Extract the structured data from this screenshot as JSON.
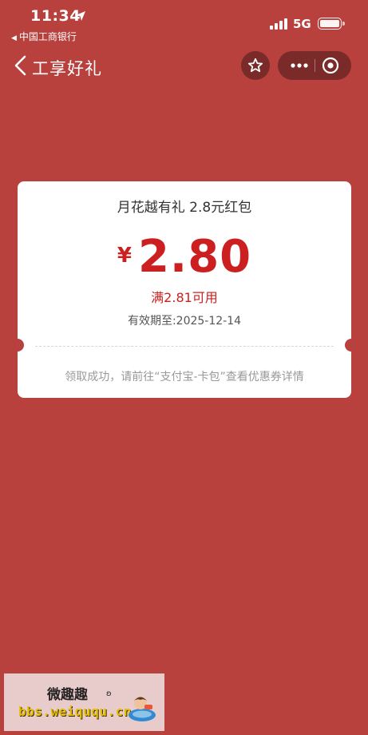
{
  "status_bar": {
    "time": "11:34",
    "back_app": "中国工商银行",
    "network": "5G"
  },
  "nav": {
    "title": "工享好礼"
  },
  "coupon": {
    "title": "月花越有礼  2.8元红包",
    "currency": "¥",
    "amount": "2.80",
    "threshold": "满2.81可用",
    "valid_until": "有效期至:2025-12-14",
    "tip": "领取成功，请前往“支付宝-卡包”查看优惠券详情"
  },
  "watermark": {
    "title": "微趣趣",
    "url": "bbs.weiququ.cn"
  },
  "colors": {
    "background": "#b8403d",
    "accent_red": "#cc1f1f",
    "capsule": "#7a2a28"
  },
  "icons": [
    "location-arrow-icon",
    "signal-icon",
    "battery-icon",
    "back-chevron-icon",
    "star-icon",
    "more-icon",
    "close-target-icon"
  ]
}
